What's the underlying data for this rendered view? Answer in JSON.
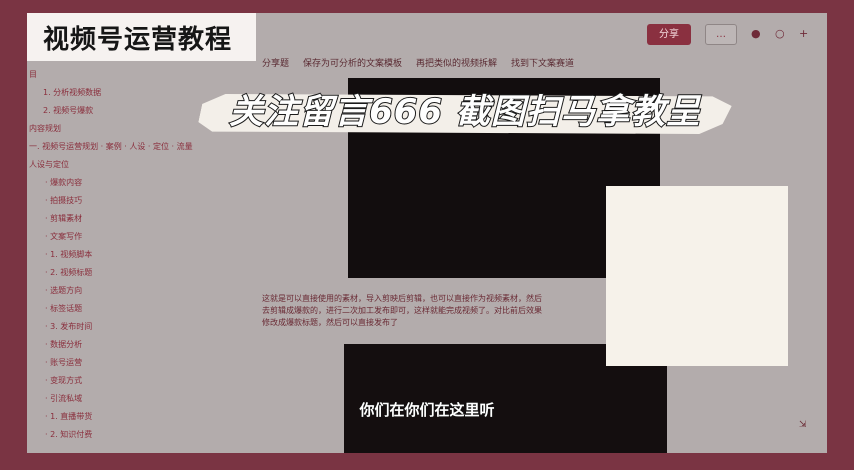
{
  "overlay": {
    "corner_title": "视频号运营教程",
    "banner": "关注留言666 截图扫马拿教呈",
    "subtitle": "你们在你们在这里听"
  },
  "topbar": {
    "share_label": "分享",
    "second_label": "…",
    "icons": [
      "bell-icon",
      "help-icon",
      "add-icon"
    ]
  },
  "breadcrumb": [
    "分享题",
    "保存为可分析的文案模板",
    "再把类似的视频拆解",
    "找到下文案赛道"
  ],
  "sidebar": {
    "items": [
      "目",
      "1. 分析视频数据",
      "2. 视频号爆款",
      "内容规划",
      "一. 视频号运营规划 · 案例 · 人设 · 定位 · 流量",
      "人设与定位",
      "· 爆款内容",
      "· 拍摄技巧",
      "· 剪辑素材",
      "· 文案写作",
      "· 1. 视频脚本",
      "· 2. 视频标题",
      "· 选题方向",
      "· 标签话题",
      "· 3. 发布时间",
      "· 数据分析",
      "· 账号运营",
      "· 变现方式",
      "· 引流私域",
      "· 1. 直播带货",
      "· 2. 知识付费"
    ]
  },
  "content": {
    "paragraph_lines": [
      "这就是可以直接使用的素材，导入剪映后剪辑，也可以直接作为视频素材，然后",
      "去剪辑成爆款的，进行二次加工发布即可，这样就能完成视频了。对比前后效果",
      "修改成爆款标题，然后可以直接发布了"
    ]
  },
  "corner_button_label": "⇲"
}
